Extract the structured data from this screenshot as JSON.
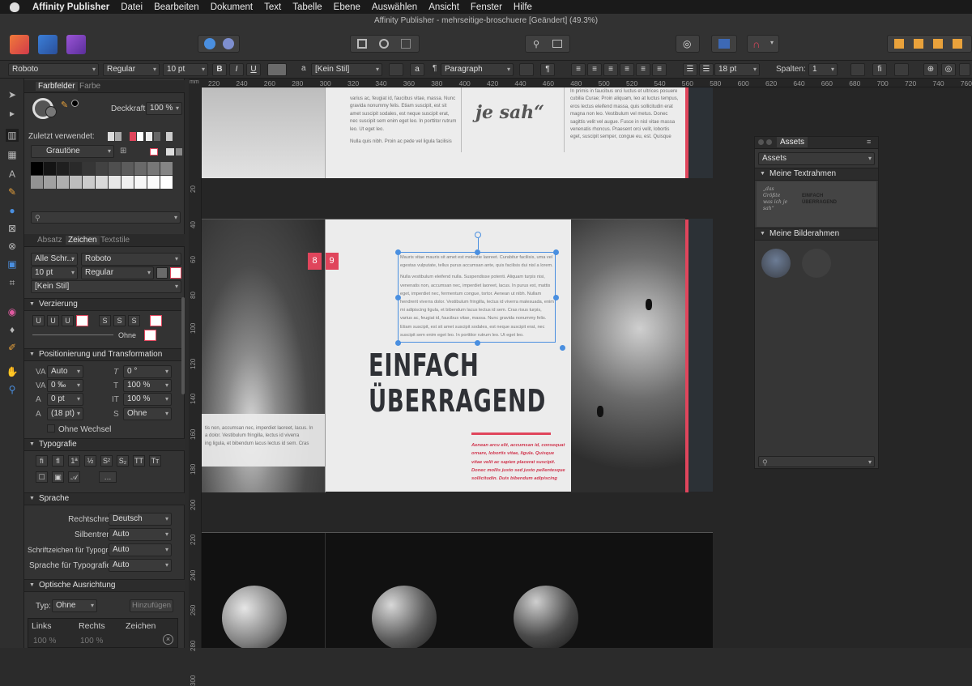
{
  "menubar": {
    "app_name": "Affinity Publisher",
    "items": [
      "Datei",
      "Bearbeiten",
      "Dokument",
      "Text",
      "Tabelle",
      "Ebene",
      "Auswählen",
      "Ansicht",
      "Fenster",
      "Hilfe"
    ]
  },
  "window": {
    "title": "Affinity Publisher - mehrseitige-broschuere [Geändert] (49.3%)"
  },
  "context_bar": {
    "font": "Roboto",
    "style": "Regular",
    "size": "10 pt",
    "bold": "B",
    "italic": "I",
    "underline": "U",
    "char_style": "[Kein Stil]",
    "para_label": "a",
    "para_mark": "¶",
    "para_style": "Paragraph",
    "leading": "18 pt",
    "columns_label": "Spalten:",
    "columns": "1"
  },
  "farbfelder": {
    "tab_active": "Farbfelder",
    "tab_other": "Farbe",
    "opacity_label": "Deckkraft:",
    "opacity_value": "100 %",
    "recent_label": "Zuletzt verwendet:",
    "palette": "Grautöne"
  },
  "zeichen": {
    "tabs": [
      "Absatz",
      "Zeichen",
      "Textstile"
    ],
    "font_scope": "Alle Schr...",
    "font": "Roboto",
    "size": "10 pt",
    "style": "Regular",
    "char_style": "[Kein Stil]",
    "verzierung_title": "Verzierung",
    "u1": "U",
    "u2": "U",
    "u3": "U",
    "s1": "S",
    "s2": "S",
    "s3": "S",
    "ohne": "Ohne",
    "pos_title": "Positionierung und Transformation",
    "pos_fields": [
      "Auto",
      "0 ‰",
      "0 pt",
      "(18 pt)"
    ],
    "pos_fields_right": [
      "0 °",
      "100 %",
      "100 %",
      "Ohne"
    ],
    "ohne_wechsel": "Ohne Wechsel",
    "typografie_title": "Typografie",
    "sprache_title": "Sprache",
    "sprache_rows": [
      {
        "label": "Rechtschreibung:",
        "value": "Deutsch"
      },
      {
        "label": "Silbentrennung:",
        "value": "Auto"
      },
      {
        "label": "Schriftzeichen für Typografie:",
        "value": "Auto"
      },
      {
        "label": "Sprache für Typografie:",
        "value": "Auto"
      }
    ],
    "optik_title": "Optische Ausrichtung",
    "typ_label": "Typ:",
    "typ_value": "Ohne",
    "hinzufuegen": "Hinzufügen",
    "col_headers": [
      "Links",
      "Rechts",
      "Zeichen"
    ],
    "col_values": [
      "100 %",
      "100 %"
    ]
  },
  "rulers": {
    "unit": "mm",
    "top": [
      "220",
      "240",
      "260",
      "280",
      "300",
      "320",
      "340",
      "360",
      "380",
      "400",
      "420",
      "440",
      "460",
      "480",
      "500",
      "520",
      "540",
      "560",
      "580",
      "600",
      "620",
      "640",
      "660",
      "680",
      "700",
      "720",
      "740",
      "760"
    ],
    "left": [
      "20",
      "40",
      "60",
      "80",
      "100",
      "120",
      "140",
      "160",
      "180",
      "200",
      "220",
      "240",
      "260",
      "280",
      "300"
    ]
  },
  "document": {
    "top_quote": "je sah“",
    "top_col1": [
      "varius ac, feugiat id, faucibus vitae, massa. Nunc",
      "gravida nonummy felis. Etiam suscipit, est sit",
      "amet suscipit sodales, est neque suscipit erat,",
      "nec suscipit sem enim eget leo. In porttitor rutrum",
      "leo. Ut eget leo.",
      "",
      "Nulla quis nibh. Proin ac pede vel ligula facilisis"
    ],
    "top_col2": [
      "cubilia Curae; Proin aliquam, leo at luctus tempus,",
      "eros lectus eleifend massa, quis sollicitudin erat",
      "magna non leo. Vestibulum vel metus. Donec",
      "sagittis velit vel augue. Fusce in nisl vitae massa",
      "venenatis rhoncus. Praesent orci velit, lobortis",
      "eget, suscipit semper, congue eu, est. Quisque"
    ],
    "top_col2_first": "In primis in faucibus orci luctus et ultrices posuere",
    "page_numbers": [
      "8",
      "9"
    ],
    "frame_text": [
      "Mauris vitae mauris sit amet est molestie laoreet. Curabitur facilisis, uma vel",
      "egestas vulputate, tellus purus accumsan ante, quis facilisis dui nisl a lorem.",
      "",
      "Nulla vestibulum eleifend nulla. Suspendisse potenti. Aliquam turpis nisi,",
      "venenatis non, accumsan nec, imperdiet laoreet, lacus. In purus est, mattis",
      "eget, imperdiet nec, fermentum congue, tortor. Aenean ut nibh. Nullam",
      "hendrerit viverra dolor. Vestibulum fringilla, lectus id viverra malesuada, enim",
      "mi adipiscing ligula, et bibendum lacus lectus id sem. Cras risus turpis,",
      "varius ac, feugiat id, faucibus vitae, massa. Nunc gravida nonummy felis.",
      "Etiam suscipit, est sit amet suscipit sodales, est neque suscipit erat, nec",
      "suscipit sem enim eget leo. In porttitor rutrum leo. Ut eget leo."
    ],
    "headline_1": "EINFACH",
    "headline_2": "ÜBERRAGEND",
    "left_text": [
      "tis non, accumsan nec, imperdiet laoreet, lacus. In",
      "a dolor. Vestibulum fringilla, lectus id viverra",
      "ing ligula, et bibendum lacus lectus id sem. Cras"
    ],
    "accent_text": [
      "Aenean arcu elit, accumsan id, consequat",
      "ornare, lobortis vitae, ligula. Quisque",
      "vitae velit ac sapien placerat suscipit.",
      "Donec mollis justo sed justo pellentesque",
      "sollicitudin. Duis bibendum adipiscing"
    ]
  },
  "assets": {
    "tab": "Assets",
    "dropdown": "Assets",
    "cat1": "Meine Textrahmen",
    "thumb_quote": "„das Größte was ich je sah“",
    "thumb_head": "EINFACH ÜBERRAGEND",
    "cat2": "Meine Bilderahmen"
  },
  "colors": {
    "accent": "#e0455c",
    "bg": "#2b2b2b",
    "panel": "#333333"
  }
}
